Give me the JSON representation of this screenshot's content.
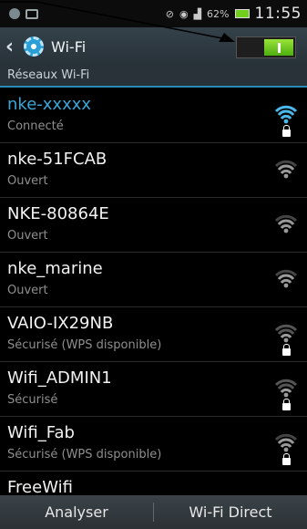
{
  "status_bar": {
    "battery": "62%",
    "time": "11:55"
  },
  "action_bar": {
    "title": "Wi-Fi",
    "toggle_state": "on"
  },
  "section_header": "Réseaux Wi-Fi",
  "networks": [
    {
      "name": "nke-xxxxx",
      "status": "Connecté",
      "secured": true,
      "strength": "full",
      "connected": true
    },
    {
      "name": "nke-51FCAB",
      "status": "Ouvert",
      "secured": false,
      "strength": "3/4"
    },
    {
      "name": "NKE-80864E",
      "status": "Ouvert",
      "secured": false,
      "strength": "3/4"
    },
    {
      "name": "nke_marine",
      "status": "Ouvert",
      "secured": false,
      "strength": "3/4"
    },
    {
      "name": "VAIO-IX29NB",
      "status": "Sécurisé (WPS disponible)",
      "secured": true,
      "strength": "weak"
    },
    {
      "name": "Wifi_ADMIN1",
      "status": "Sécurisé",
      "secured": true,
      "strength": "weak"
    },
    {
      "name": "Wifi_Fab",
      "status": "Sécurisé (WPS disponible)",
      "secured": true,
      "strength": "3/4"
    },
    {
      "name": "FreeWifi",
      "status": "",
      "secured": false,
      "strength": ""
    }
  ],
  "bottom_bar": {
    "scan_label": "Analyser",
    "wifi_direct_label": "Wi-Fi Direct"
  },
  "colors": {
    "accent": "#39a7d9",
    "toggle_on": "#6fd11c"
  }
}
